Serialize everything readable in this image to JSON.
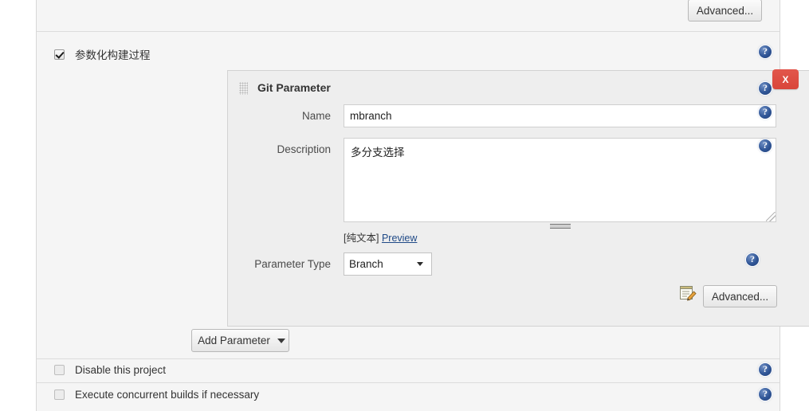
{
  "page": {
    "top_advanced_label": "Advanced...",
    "parameterized_build_label": "参数化构建过程",
    "disable_project_label": "Disable this project",
    "concurrent_builds_label": "Execute concurrent builds if necessary",
    "add_parameter_label": "Add Parameter"
  },
  "git_parameter": {
    "title": "Git Parameter",
    "close_label": "X",
    "name_label": "Name",
    "name_value": "mbranch",
    "description_label": "Description",
    "description_value": "多分支选择",
    "plain_text_note": "[纯文本]",
    "preview_link": "Preview",
    "parameter_type_label": "Parameter Type",
    "parameter_type_value": "Branch",
    "parameter_type_options": [
      "Branch"
    ],
    "advanced_label": "Advanced..."
  },
  "icons": {
    "help": "help-icon",
    "drag": "drag-handle-icon",
    "edit": "edit-note-icon",
    "caret": "chevron-down-icon"
  },
  "colors": {
    "panel_bg": "#eeeeee",
    "form_bg": "#f5f5f5",
    "close_red": "#d9453a",
    "help_blue": "#2f5596",
    "link_blue": "#204a87"
  }
}
